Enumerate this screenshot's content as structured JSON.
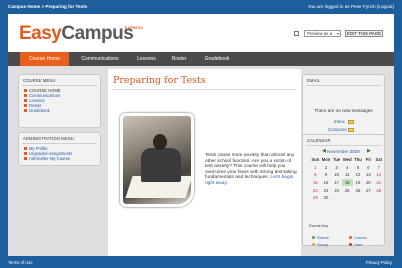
{
  "topbar": {
    "breadcrumb": "Campus Home > Preparing for Tests",
    "login_status": "You are logged in as Peter Fynch (Logout)"
  },
  "brand": {
    "easy": "Easy",
    "campus": "Campus",
    "tag": "EXPRESS"
  },
  "controls": {
    "preview_value": "Preview as a",
    "edit_label": "EDIT THIS PAGE"
  },
  "nav": {
    "tabs": [
      "Course Home",
      "Communications",
      "Lessons",
      "Roster",
      "Gradebook"
    ],
    "active": "Course Home"
  },
  "course_menu": {
    "title": "Course Menu",
    "items": [
      "Course Home",
      "Communications",
      "Lessons",
      "Roster",
      "Gradebook"
    ]
  },
  "admin_menu": {
    "title": "Administration Menu",
    "items": [
      "My Profile",
      "Ungraded Assignments",
      "Administer My Course"
    ]
  },
  "content": {
    "title": "Preparing for Tests",
    "body": "Tests cause more anxiety than almost any other school function. Are you a victim of test anxiety? This course will help you overcome your fears with strong test-taking fundamentals and techniques.",
    "link": "Let's begin right away."
  },
  "email": {
    "title": "Email",
    "message": "There are no new messages",
    "inbox": "Inbox",
    "compose": "Compose"
  },
  "calendar": {
    "title": "Calendar",
    "month": "November 2009",
    "days": [
      "Sun",
      "Mon",
      "Tue",
      "Wed",
      "Thu",
      "Fri",
      "Sat"
    ],
    "weeks": [
      [
        "1",
        "2",
        "3",
        "4",
        "5",
        "6",
        "7"
      ],
      [
        "8",
        "9",
        "10",
        "11",
        "12",
        "13",
        "14"
      ],
      [
        "15",
        "16",
        "17",
        "18",
        "19",
        "20",
        "21"
      ],
      [
        "22",
        "23",
        "24",
        "25",
        "26",
        "27",
        "28"
      ],
      [
        "29",
        "30",
        "",
        "",
        "",
        "",
        ""
      ]
    ],
    "today": "18",
    "events_key_title": "Events Key",
    "events_key": [
      "Global",
      "Course",
      "Group",
      "User"
    ]
  },
  "footer": {
    "left": "Terms of Use",
    "right": "Privacy Policy"
  },
  "colors": {
    "frame": "#1f5e9c",
    "accent": "#e8601c",
    "nav": "#4b4b4b",
    "link": "#2a5aa8"
  },
  "icons": {
    "checkbox": "checkbox-icon",
    "envelope": "envelope-icon",
    "bullet": "square-bullet-icon"
  }
}
